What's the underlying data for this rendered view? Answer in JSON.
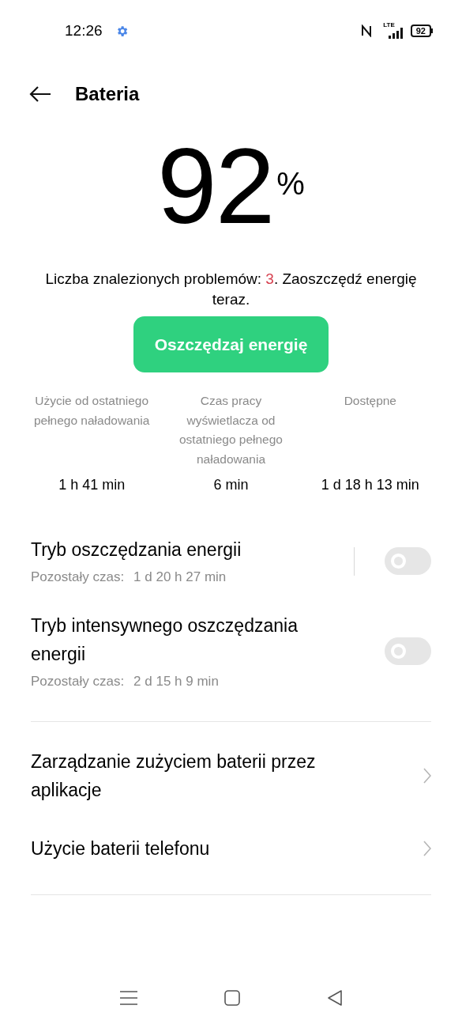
{
  "status_bar": {
    "time": "12:26",
    "network": "LTE",
    "battery": "92"
  },
  "header": {
    "title": "Bateria"
  },
  "battery": {
    "percent": "92",
    "unit": "%"
  },
  "message": {
    "prefix": "Liczba znalezionych problemów: ",
    "count": "3",
    "suffix": ". Zaoszczędź energię teraz."
  },
  "action_button": "Oszczędzaj energię",
  "stats": [
    {
      "label": "Użycie od ostatniego pełnego naładowania",
      "value": "1 h 41 min"
    },
    {
      "label": "Czas pracy wyświetlacza od ostatniego pełnego naładowania",
      "value": "6 min"
    },
    {
      "label": "Dostępne",
      "value": "1 d 18 h 13 min"
    }
  ],
  "modes": [
    {
      "title": "Tryb oszczędzania energii",
      "remaining_label": "Pozostały czas:",
      "remaining": "1 d 20 h 27 min",
      "on": false,
      "separator": true
    },
    {
      "title": "Tryb intensywnego oszczędzania energii",
      "remaining_label": "Pozostały czas:",
      "remaining": "2 d 15 h 9 min",
      "on": false,
      "separator": false
    }
  ],
  "links": [
    {
      "label": "Zarządzanie zużyciem baterii przez aplikacje"
    },
    {
      "label": "Użycie baterii telefonu"
    }
  ]
}
